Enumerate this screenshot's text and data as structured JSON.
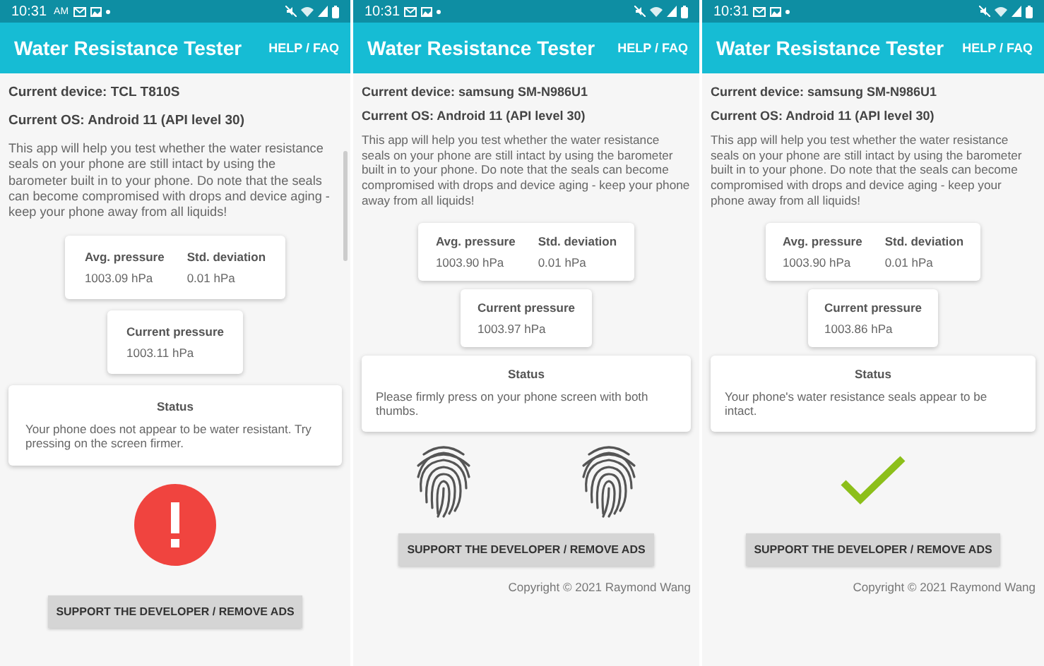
{
  "panels": [
    {
      "status_bar": {
        "time": "10:31",
        "meridiem": "AM"
      },
      "app_bar": {
        "title": "Water Resistance Tester",
        "action": "HELP / FAQ"
      },
      "device": "Current device: TCL T810S",
      "os": "Current OS: Android 11 (API level 30)",
      "intro": "This app will help you test whether the water resistance seals on your phone are still intact by using the barometer built in to your phone. Do note that the seals can become compromised with drops and device aging - keep your phone away from all liquids!",
      "stats": [
        {
          "label": "Avg. pressure",
          "value": "1003.09 hPa"
        },
        {
          "label": "Std. deviation",
          "value": "0.01 hPa"
        }
      ],
      "current": {
        "label": "Current pressure",
        "value": "1003.11 hPa"
      },
      "status": {
        "title": "Status",
        "message": "Your phone does not appear to be water resistant. Try pressing on the screen firmer."
      },
      "indicator": {
        "kind": "alert"
      },
      "button": "SUPPORT THE DEVELOPER / REMOVE ADS",
      "scrollbar": true
    },
    {
      "status_bar": {
        "time": "10:31"
      },
      "app_bar": {
        "title": "Water Resistance Tester",
        "action": "HELP / FAQ"
      },
      "device": "Current device: samsung SM-N986U1",
      "os": "Current OS: Android 11 (API level 30)",
      "intro": "This app will help you test whether the water resistance seals on your phone are still intact by using the barometer built in to your phone. Do note that the seals can become compromised with drops and device aging - keep your phone away from all liquids!",
      "stats": [
        {
          "label": "Avg. pressure",
          "value": "1003.90 hPa"
        },
        {
          "label": "Std. deviation",
          "value": "0.01 hPa"
        }
      ],
      "current": {
        "label": "Current pressure",
        "value": "1003.97 hPa"
      },
      "status": {
        "title": "Status",
        "message": "Please firmly press on your phone screen with both thumbs."
      },
      "indicator": {
        "kind": "thumbs"
      },
      "button": "SUPPORT THE DEVELOPER / REMOVE ADS",
      "copyright": "Copyright © 2021 Raymond Wang"
    },
    {
      "status_bar": {
        "time": "10:31"
      },
      "app_bar": {
        "title": "Water Resistance Tester",
        "action": "HELP / FAQ"
      },
      "device": "Current device: samsung SM-N986U1",
      "os": "Current OS: Android 11 (API level 30)",
      "intro": "This app will help you test whether the water resistance seals on your phone are still intact by using the barometer built in to your phone. Do note that the seals can become compromised with drops and device aging - keep your phone away from all liquids!",
      "stats": [
        {
          "label": "Avg. pressure",
          "value": "1003.90 hPa"
        },
        {
          "label": "Std. deviation",
          "value": "0.01 hPa"
        }
      ],
      "current": {
        "label": "Current pressure",
        "value": "1003.86 hPa"
      },
      "status": {
        "title": "Status",
        "message": "Your phone's water resistance seals appear to be intact."
      },
      "indicator": {
        "kind": "check"
      },
      "button": "SUPPORT THE DEVELOPER / REMOVE ADS",
      "copyright": "Copyright © 2021 Raymond Wang"
    }
  ]
}
